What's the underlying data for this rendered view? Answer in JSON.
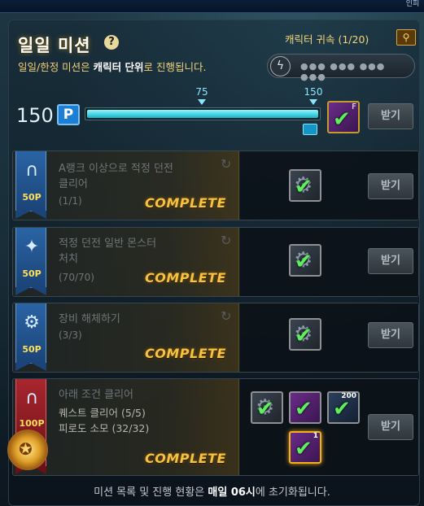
{
  "window": {
    "corner_label": "인피"
  },
  "header": {
    "title": "일일 미션",
    "help_icon": "question-icon",
    "subtitle_pre": "일일/한정 미션은 ",
    "subtitle_bold": "캐릭터 단위",
    "subtitle_post": "로 진행됩니다.",
    "bind_label": "캐릭터 귀속  (1/20)",
    "search_icon": "search-icon",
    "code_icon": "lightning-icon",
    "code_text": "●●● ●●● ●●● ●●●"
  },
  "progress": {
    "points": "150",
    "points_badge": "P",
    "current": 150,
    "max": 150,
    "ticks": [
      "75",
      "150"
    ],
    "claim_label": "받기",
    "reward_tag": "F"
  },
  "missions": [
    {
      "title_line1": "A랭크 이상으로 적정 던전",
      "title_line2": "클리어",
      "progress": "(1/1)",
      "points": "50P",
      "status": "COMPLETE",
      "icon": "arch-icon",
      "claim_label": "받기"
    },
    {
      "title_line1": "적정 던전 일반 몬스터",
      "title_line2": "처치",
      "progress": "(70/70)",
      "points": "50P",
      "status": "COMPLETE",
      "icon": "crystal-icon",
      "claim_label": "받기"
    },
    {
      "title_line1": "장비 해체하기",
      "progress": "(3/3)",
      "points": "50P",
      "status": "COMPLETE",
      "icon": "gear-icon",
      "claim_label": "받기"
    },
    {
      "title_line1": "아래 조건 클리어",
      "sub1": "퀘스트 클리어 (5/5)",
      "sub2": "피로도 소모 (32/32)",
      "points": "100P",
      "status": "COMPLETE",
      "icon": "arch-icon",
      "claim_label": "받기",
      "reward_tags": [
        "",
        "",
        "200",
        "1"
      ]
    }
  ],
  "footer": {
    "pre": "미션 목록 및 진행 현황은 ",
    "bold": "매일 06시",
    "post": "에 초기화됩니다."
  },
  "colors": {
    "accent": "#f5c242",
    "progress": "#15b4c7",
    "ribbon_blue": "#2a64a5",
    "ribbon_red": "#a9262e"
  }
}
